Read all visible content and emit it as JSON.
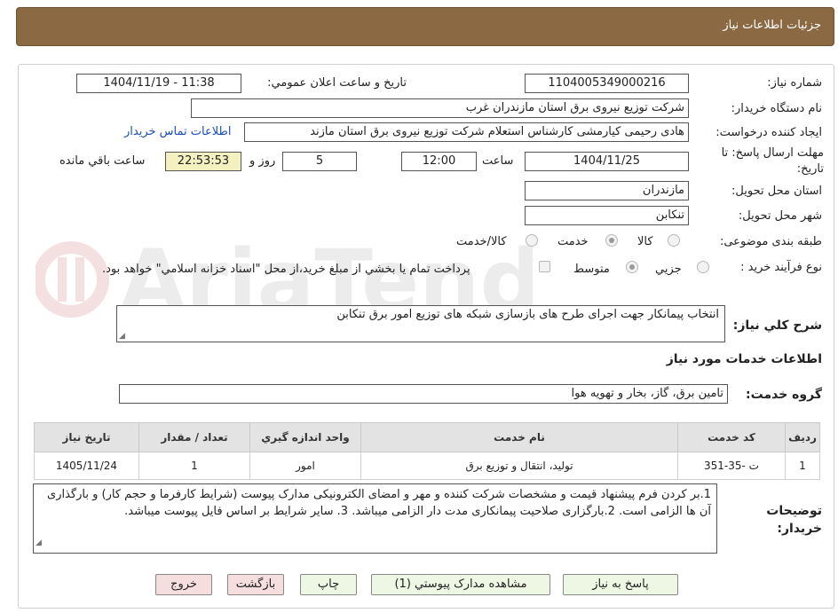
{
  "header": {
    "title": "جزئیات اطلاعات نیاز"
  },
  "form": {
    "need_number_label": "شماره نیاز:",
    "need_number": "1104005349000216",
    "announce_label": "تاریخ و ساعت اعلان عمومي:",
    "announce_value": "1404/11/19 - 11:38",
    "buyer_org_label": "نام دستگاه خريدار:",
    "buyer_org": "شرکت توزیع نیروی برق استان مازندران غرب",
    "requester_label": "ایجاد کننده درخواست:",
    "requester": "هادی رحیمی کیارمشی کارشناس استعلام شرکت توزیع نیروی برق استان مازند",
    "contact_link": "اطلاعات تماس خريدار",
    "deadline_label": "مهلت ارسال پاسخ: تا تاریخ:",
    "deadline_date": "1404/11/25",
    "time_label": "ساعت",
    "deadline_time": "12:00",
    "days_value": "5",
    "days_label": "روز و",
    "remaining_time": "22:53:53",
    "remaining_label": "ساعت باقي مانده",
    "province_label": "استان محل تحويل:",
    "province": "مازندران",
    "city_label": "شهر محل تحويل:",
    "city": "تنکابن",
    "category_label": "طبقه بندی موضوعی:",
    "category_options": [
      "کالا",
      "خدمت",
      "کالا/خدمت"
    ],
    "category_selected": "خدمت",
    "process_label": "نوع فرآيند خريد :",
    "process_options": [
      "جزيي",
      "متوسط"
    ],
    "process_selected": "متوسط",
    "payment_note": "پرداخت تمام يا بخشي از مبلغ خريد،از محل \"اسناد خزانه اسلامي\" خواهد بود.",
    "description_label": "شرح كلي نياز:",
    "description": "انتخاب پیمانکار جهت اجرای طرح های بازسازی شبکه های توزیع امور برق تنکابن",
    "services_title": "اطلاعات خدمات مورد نياز",
    "service_group_label": "گروه خدمت:",
    "service_group": "تامین برق، گاز، بخار و تهویه هوا"
  },
  "table": {
    "headers": [
      "رديف",
      "كد خدمت",
      "نام خدمت",
      "واحد اندازه گيري",
      "تعداد / مقدار",
      "تاريخ نياز"
    ],
    "rows": [
      [
        "1",
        "ت -35-351",
        "تولید، انتقال و توزیع برق",
        "امور",
        "1",
        "1405/11/24"
      ]
    ]
  },
  "notes": {
    "label": "توضيحات خريدار:",
    "text": "1.بر کردن فرم پیشنهاد قیمت و مشخصات شرکت کننده و مهر و امضای الکترونیکی مدارک پیوست (شرایط کارفرما و حجم کار) و بارگذاری آن ها الزامی است. 2.بارگزاری صلاحیت پیمانکاری مدت دار الزامی میباشد. 3. سایر شرایط بر اساس فایل پیوست میباشد."
  },
  "buttons": {
    "reply": "پاسخ به نياز",
    "attachments": "مشاهده مدارک پيوستي (1)",
    "print": "چاپ",
    "back": "بازگشت",
    "exit": "خروج"
  },
  "colors": {
    "header_bg": "#8b6a43",
    "link": "#1a4fb5",
    "remaining_bg": "#f4f0c0",
    "button_green": "#eef7e4",
    "button_pink": "#f6dede"
  }
}
